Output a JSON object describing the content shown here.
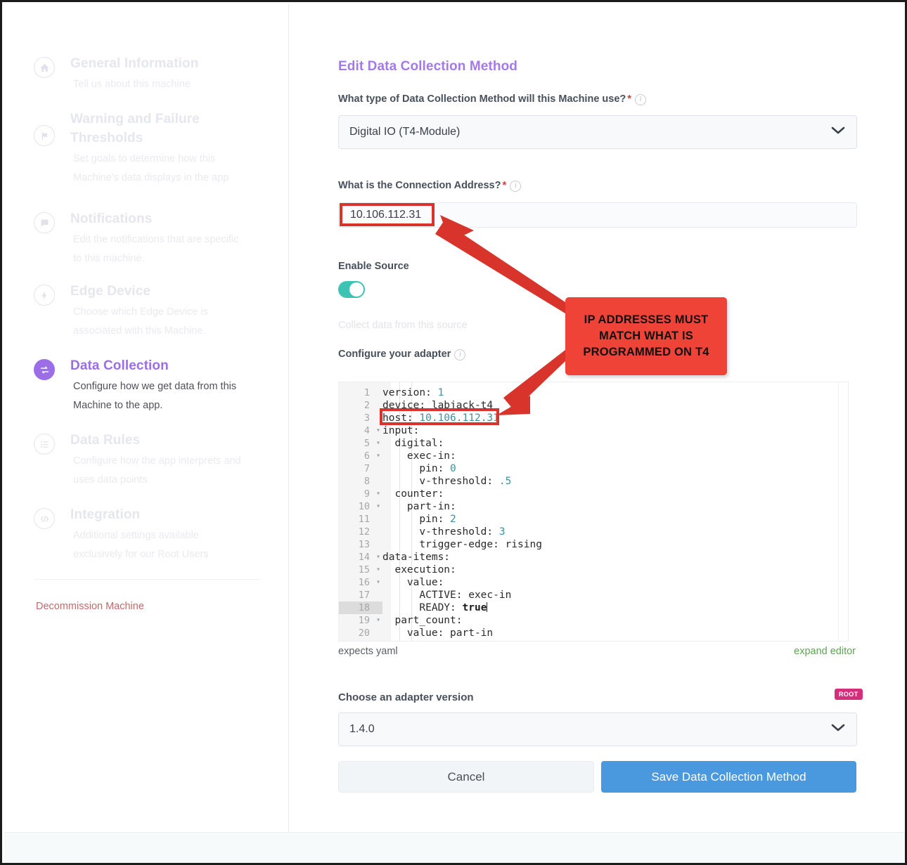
{
  "sidebar": {
    "items": [
      {
        "icon": "home-icon",
        "title": "General Information",
        "desc": "Tell us about this machine",
        "active": false
      },
      {
        "icon": "flag-icon",
        "title": "Warning and Failure Thresholds",
        "desc": "Set goals to determine how this Machine's data displays in the app",
        "active": false
      },
      {
        "icon": "chat-bubble-icon",
        "title": "Notifications",
        "desc": "Edit the notifications that are specific to this machine.",
        "active": false
      },
      {
        "icon": "lightning-bolt-icon",
        "title": "Edge Device",
        "desc": "Choose which Edge Device is associated with this Machine.",
        "active": false
      },
      {
        "icon": "transfer-arrows-icon",
        "title": "Data Collection",
        "desc": "Configure how we get data from this Machine to the app.",
        "active": true
      },
      {
        "icon": "list-icon",
        "title": "Data Rules",
        "desc": "Configure how the app interprets and uses data points",
        "active": false
      },
      {
        "icon": "code-brackets-icon",
        "title": "Integration",
        "desc": "Additional settings available exclusively for our Root Users",
        "active": false
      }
    ],
    "decommission_label": "Decommission Machine"
  },
  "form": {
    "title": "Edit Data Collection Method",
    "method_label": "What type of Data Collection Method will this Machine use?",
    "method_value": "Digital IO (T4-Module)",
    "address_label": "What is the Connection Address?",
    "address_value": "10.106.112.31",
    "enable_source_label": "Enable Source",
    "enable_source_state": "on",
    "collect_note": "Collect data from this source",
    "adapter_label": "Configure your adapter",
    "expects_label": "expects yaml",
    "expand_label": "expand editor",
    "version_label": "Choose an adapter version",
    "version_value": "1.4.0",
    "root_badge": "ROOT",
    "cancel_label": "Cancel",
    "save_label": "Save Data Collection Method",
    "required_marker": "*"
  },
  "editor": {
    "lines": [
      {
        "n": "1",
        "fold": false,
        "active": false,
        "indent": 0,
        "text": "version: ",
        "num": "1"
      },
      {
        "n": "2",
        "fold": false,
        "active": false,
        "indent": 0,
        "text": "device: labjack-t4",
        "num": ""
      },
      {
        "n": "3",
        "fold": false,
        "active": false,
        "indent": 0,
        "text": "host: ",
        "num": "10.106.112.31"
      },
      {
        "n": "4",
        "fold": true,
        "active": false,
        "indent": 0,
        "text": "input:",
        "num": ""
      },
      {
        "n": "5",
        "fold": true,
        "active": false,
        "indent": 1,
        "text": "  digital:",
        "num": ""
      },
      {
        "n": "6",
        "fold": true,
        "active": false,
        "indent": 2,
        "text": "    exec-in:",
        "num": ""
      },
      {
        "n": "7",
        "fold": false,
        "active": false,
        "indent": 3,
        "text": "      pin: ",
        "num": "0"
      },
      {
        "n": "8",
        "fold": false,
        "active": false,
        "indent": 3,
        "text": "      v-threshold: ",
        "num": ".5"
      },
      {
        "n": "9",
        "fold": true,
        "active": false,
        "indent": 1,
        "text": "  counter:",
        "num": ""
      },
      {
        "n": "10",
        "fold": true,
        "active": false,
        "indent": 2,
        "text": "    part-in:",
        "num": ""
      },
      {
        "n": "11",
        "fold": false,
        "active": false,
        "indent": 3,
        "text": "      pin: ",
        "num": "2"
      },
      {
        "n": "12",
        "fold": false,
        "active": false,
        "indent": 3,
        "text": "      v-threshold: ",
        "num": "3"
      },
      {
        "n": "13",
        "fold": false,
        "active": false,
        "indent": 3,
        "text": "      trigger-edge: rising",
        "num": ""
      },
      {
        "n": "14",
        "fold": true,
        "active": false,
        "indent": 0,
        "text": "data-items:",
        "num": ""
      },
      {
        "n": "15",
        "fold": true,
        "active": false,
        "indent": 1,
        "text": "  execution:",
        "num": ""
      },
      {
        "n": "16",
        "fold": true,
        "active": false,
        "indent": 2,
        "text": "    value:",
        "num": ""
      },
      {
        "n": "17",
        "fold": false,
        "active": false,
        "indent": 3,
        "text": "      ACTIVE: exec-in",
        "num": ""
      },
      {
        "n": "18",
        "fold": false,
        "active": true,
        "indent": 3,
        "text": "      READY: ",
        "bold": "true",
        "num": ""
      },
      {
        "n": "19",
        "fold": true,
        "active": false,
        "indent": 1,
        "text": "  part_count:",
        "num": ""
      },
      {
        "n": "20",
        "fold": false,
        "active": false,
        "indent": 2,
        "text": "    value: part-in",
        "num": ""
      }
    ]
  },
  "annotations": {
    "callout_line1": "IP ADDRESSES MUST",
    "callout_line2": "MATCH WHAT IS",
    "callout_line3": "PROGRAMMED ON T4",
    "highlight_color": "#d9342b",
    "callout_color": "#f04338"
  }
}
